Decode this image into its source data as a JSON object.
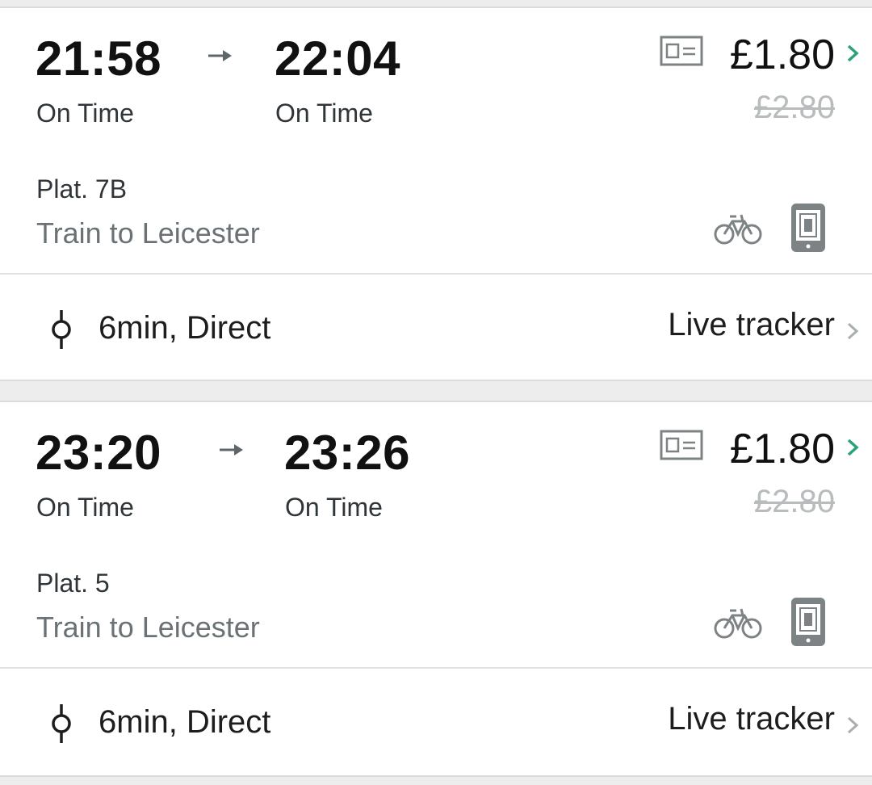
{
  "colors": {
    "accent_green": "#2aa37a",
    "muted_grey": "#b8bcbd",
    "icon_grey": "#7d8385"
  },
  "journeys": [
    {
      "departure": {
        "time": "21:58",
        "status": "On Time"
      },
      "arrival": {
        "time": "22:04",
        "status": "On Time"
      },
      "price": "£1.80",
      "original_price": "£2.80",
      "platform": "Plat. 7B",
      "destination": "Train to Leicester",
      "duration": "6min, Direct",
      "live_tracker": "Live tracker",
      "icons": [
        "ticket-icon",
        "bicycle-icon",
        "mobile-ticket-icon",
        "route-stop-icon"
      ]
    },
    {
      "departure": {
        "time": "23:20",
        "status": "On Time"
      },
      "arrival": {
        "time": "23:26",
        "status": "On Time"
      },
      "price": "£1.80",
      "original_price": "£2.80",
      "platform": "Plat. 5",
      "destination": "Train to Leicester",
      "duration": "6min, Direct",
      "live_tracker": "Live tracker",
      "icons": [
        "ticket-icon",
        "bicycle-icon",
        "mobile-ticket-icon",
        "route-stop-icon"
      ]
    }
  ]
}
